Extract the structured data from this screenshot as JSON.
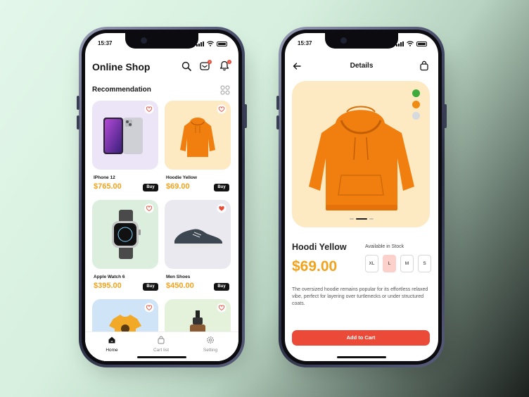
{
  "status": {
    "time": "15:37"
  },
  "shop": {
    "title": "Online Shop",
    "cart_badge": "2",
    "notification_badge": "1",
    "section_title": "Recommendation",
    "products": [
      {
        "name": "IPhone 12",
        "price": "$765.00",
        "buy_label": "Buy",
        "favorite": false,
        "bg": "#ebe5f7"
      },
      {
        "name": "Hoodie Yellow",
        "price": "$69.00",
        "buy_label": "Buy",
        "favorite": false,
        "bg": "#fde9c2"
      },
      {
        "name": "Apple Watch 6",
        "price": "$395.00",
        "buy_label": "Buy",
        "favorite": false,
        "bg": "#dcefdf"
      },
      {
        "name": "Men Shoes",
        "price": "$450.00",
        "buy_label": "Buy",
        "favorite": true,
        "bg": "#e9e9ef"
      },
      {
        "name": "",
        "price": "",
        "buy_label": "",
        "favorite": false,
        "bg": "#cfe4f6"
      },
      {
        "name": "",
        "price": "",
        "buy_label": "",
        "favorite": false,
        "bg": "#e4f2dc"
      }
    ],
    "tabs": [
      {
        "label": "Home",
        "icon": "home-icon",
        "active": true
      },
      {
        "label": "Cart list",
        "icon": "bag-icon",
        "active": false
      },
      {
        "label": "Setting",
        "icon": "gear-icon",
        "active": false
      }
    ]
  },
  "details": {
    "header_title": "Details",
    "product_name": "Hoodi Yellow",
    "price": "$69.00",
    "stock_label": "Available in Stock",
    "sizes": [
      "XL",
      "L",
      "M",
      "S"
    ],
    "selected_size": "L",
    "colors": [
      "#3caa3c",
      "#ef8a12",
      "#d6d9de"
    ],
    "description": "The oversized hoodie remains popular for its effortless relaxed vibe, perfect for layering over turtlenecks or under structured coats.",
    "add_to_cart_label": "Add to Cart",
    "image_page": "2 of 3"
  },
  "colors": {
    "accent": "#f2a31e",
    "cta": "#ea4a37",
    "favorite": "#ea4a37"
  }
}
